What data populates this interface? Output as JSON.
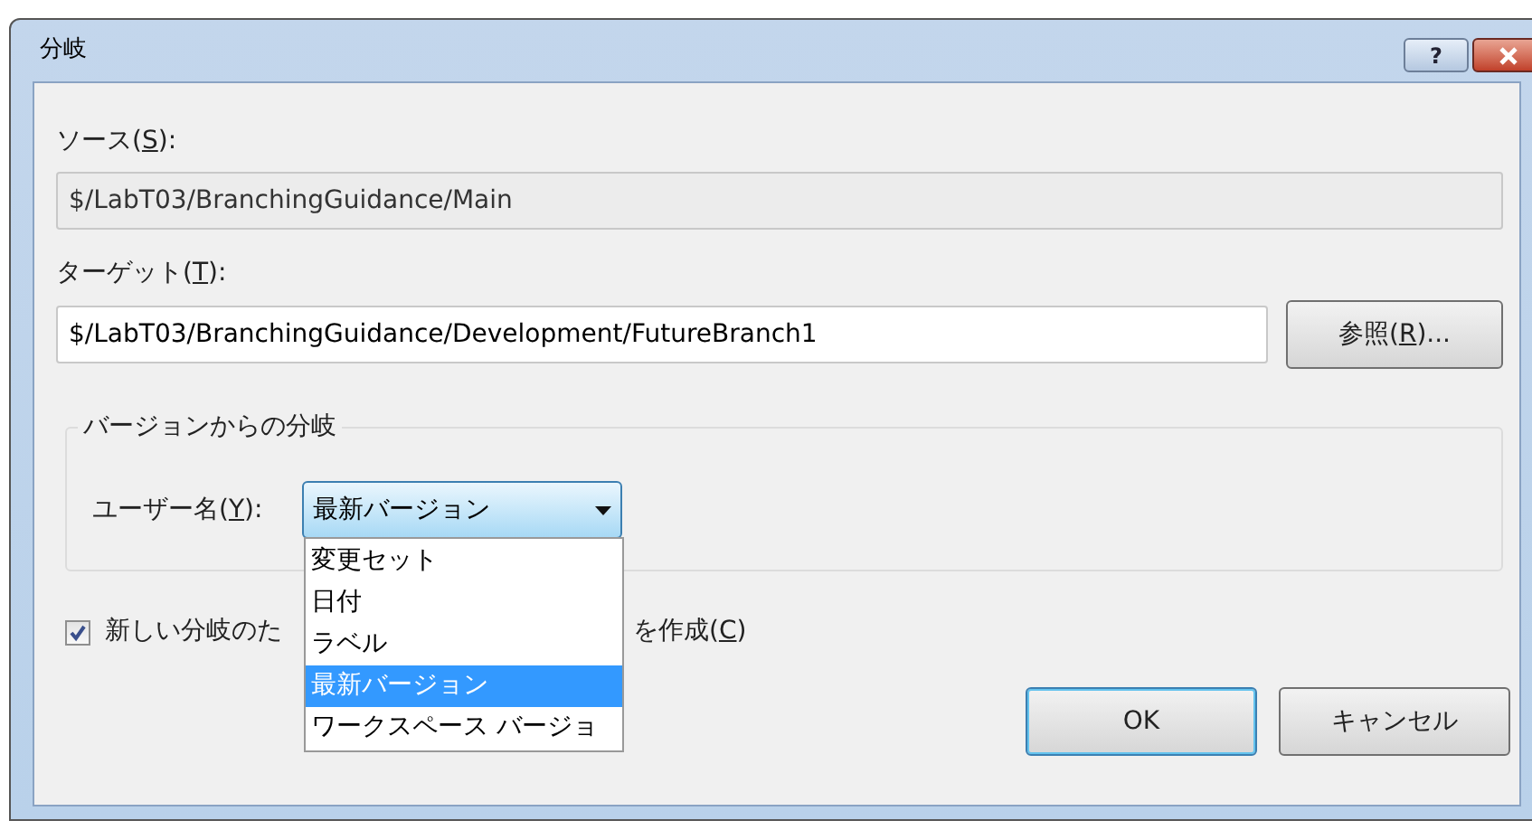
{
  "window": {
    "title": "分岐",
    "buttons": [
      {
        "kind": "help",
        "label": "?"
      },
      {
        "kind": "close"
      }
    ]
  },
  "source": {
    "label": {
      "before": "ソース(",
      "key": "S",
      "after": "):"
    },
    "value": "$/LabT03/BranchingGuidance/Main",
    "disabled": true
  },
  "target": {
    "label": {
      "before": "ターゲット(",
      "key": "T",
      "after": "):"
    },
    "value": "$/LabT03/BranchingGuidance/Development/FutureBranch1",
    "disabled": false,
    "browse": {
      "before": "参照(",
      "key": "R",
      "after": ")..."
    }
  },
  "group": {
    "title": "バージョンからの分岐",
    "field": {
      "label": {
        "before": "ユーザー名(",
        "key": "Y",
        "after": "):"
      },
      "value": "最新バージョン",
      "expanded": true,
      "options": [
        {
          "label": "変更セット",
          "selected": false
        },
        {
          "label": "日付",
          "selected": false
        },
        {
          "label": "ラベル",
          "selected": false
        },
        {
          "label": "最新バージョン",
          "selected": true
        },
        {
          "label": "ワークスペース バージョ",
          "selected": false
        }
      ]
    }
  },
  "checkbox": {
    "checked": true,
    "label_start": "新しい分岐のた",
    "label_end": {
      "before": "を作成(",
      "key": "C",
      "after": ")"
    }
  },
  "buttons": [
    {
      "label": "OK",
      "default": true
    },
    {
      "label": "キャンセル",
      "default": false
    }
  ]
}
